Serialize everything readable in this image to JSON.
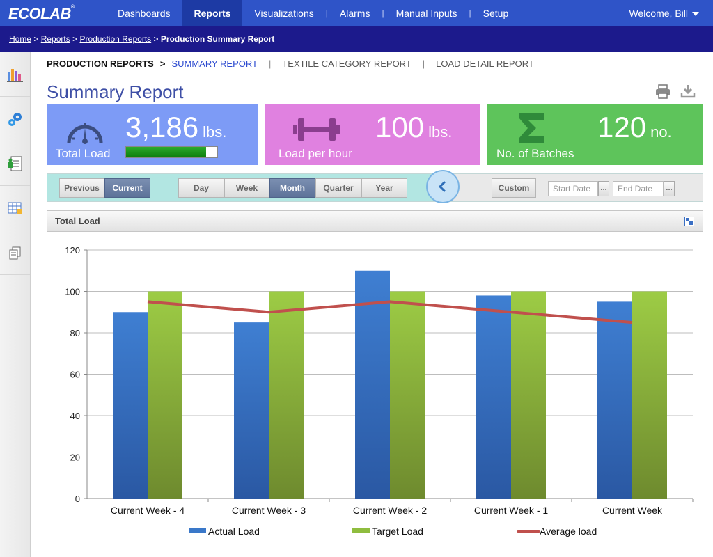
{
  "app": {
    "logo": "ECOLAB",
    "logo_mark": "®"
  },
  "nav": {
    "items": [
      {
        "label": "Dashboards",
        "active": false
      },
      {
        "label": "Reports",
        "active": true
      },
      {
        "label": "Visualizations",
        "active": false
      },
      {
        "label": "Alarms",
        "active": false
      },
      {
        "label": "Manual Inputs",
        "active": false
      },
      {
        "label": "Setup",
        "active": false
      }
    ],
    "welcome": "Welcome, Bill"
  },
  "breadcrumb": {
    "items": [
      "Home",
      "Reports",
      "Production Reports"
    ],
    "current": "Production Summary Report",
    "separator": ">"
  },
  "sidebar": {
    "icons": [
      "bar-chart-icon",
      "gears-icon",
      "report-document-icon",
      "spreadsheet-icon",
      "copy-icon"
    ]
  },
  "subtabs": {
    "parent": "PRODUCTION REPORTS",
    "arrow": ">",
    "items": [
      "SUMMARY REPORT",
      "TEXTILE CATEGORY REPORT",
      "LOAD DETAIL REPORT"
    ],
    "active_index": 0,
    "separator": "|"
  },
  "page": {
    "title": "Summary Report"
  },
  "cards": [
    {
      "value": "3,186",
      "unit": "lbs.",
      "label": "Total Load",
      "color": "#7d9bf6",
      "icon": "gauge-icon",
      "progress": 0.88
    },
    {
      "value": "100",
      "unit": "lbs.",
      "label": "Load per hour",
      "color": "#e081e0",
      "icon": "dumbbell-icon"
    },
    {
      "value": "120",
      "unit": "no.",
      "label": "No. of Batches",
      "color": "#5ec45b",
      "icon": "sigma-icon"
    }
  ],
  "filters": {
    "period_toggle": [
      "Previous",
      "Current"
    ],
    "period_selected": "Current",
    "range": [
      "Day",
      "Week",
      "Month",
      "Quarter",
      "Year"
    ],
    "range_selected": "Month",
    "custom_label": "Custom",
    "start_placeholder": "Start Date",
    "end_placeholder": "End Date",
    "picker_label": "..."
  },
  "panel": {
    "title": "Total Load"
  },
  "chart_data": {
    "type": "bar",
    "categories": [
      "Current Week - 4",
      "Current Week - 3",
      "Current Week - 2",
      "Current Week - 1",
      "Current Week"
    ],
    "series": [
      {
        "name": "Actual Load",
        "type": "bar",
        "values": [
          90,
          85,
          110,
          98,
          95
        ],
        "color": "#3a78c9"
      },
      {
        "name": "Target Load",
        "type": "bar",
        "values": [
          100,
          100,
          100,
          100,
          100
        ],
        "color": "#8fbd3f"
      },
      {
        "name": "Average load",
        "type": "line",
        "values": [
          95,
          90,
          95,
          90,
          85
        ],
        "color": "#c0504d"
      }
    ],
    "ylim": [
      0,
      120
    ],
    "yticks": [
      0,
      20,
      40,
      60,
      80,
      100,
      120
    ],
    "grid": true,
    "legend": "bottom"
  }
}
